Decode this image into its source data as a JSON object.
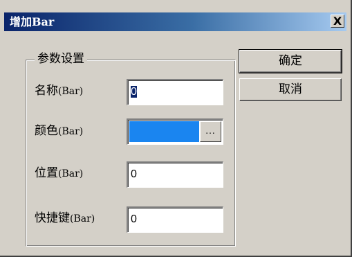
{
  "dialog": {
    "title": "增加Bar",
    "close_label": "X",
    "group_title": "参数设置",
    "ok_label": "确定",
    "cancel_label": "取消"
  },
  "fields": {
    "name": {
      "label": "名称",
      "label_en": "(Bar)",
      "value": "0"
    },
    "color": {
      "label": "颜色",
      "label_en": "(Bar)",
      "swatch_color": "#1a85f0",
      "button_label": "..."
    },
    "position": {
      "label": "位置",
      "label_en": "(Bar)",
      "value": "0"
    },
    "shortcut": {
      "label": "快捷键",
      "label_en": "(Bar)",
      "value": "0"
    }
  }
}
